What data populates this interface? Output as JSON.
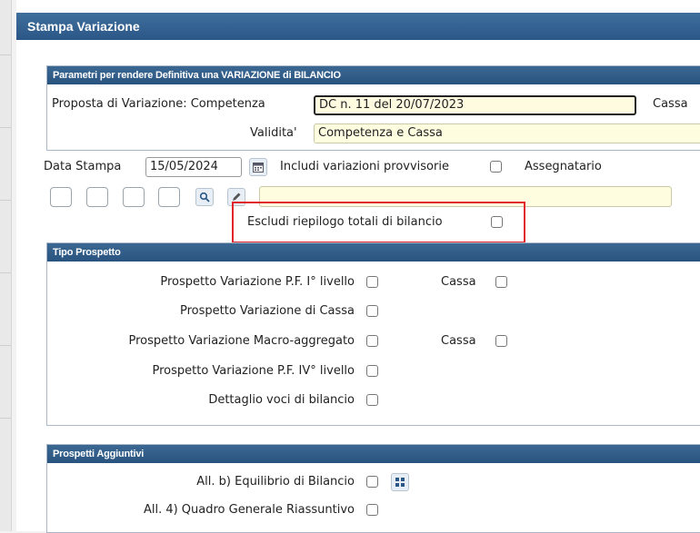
{
  "window": {
    "title": "Stampa Variazione"
  },
  "parametri": {
    "header": "Parametri per rendere Definitiva una VARIAZIONE di BILANCIO",
    "proposta_label": "Proposta di Variazione: Competenza",
    "proposta_value": "DC n. 11 del 20/07/2023",
    "cassa_label": "Cassa",
    "validita_label": "Validita'",
    "validita_value": "Competenza e Cassa"
  },
  "stampa": {
    "data_label": "Data Stampa",
    "data_value": "15/05/2024",
    "includi_label": "Includi variazioni provvisorie",
    "assegnatario_label": "Assegnatario",
    "escludi_label": "Escludi riepilogo totali di bilancio"
  },
  "tipo_prospetto": {
    "header": "Tipo Prospetto",
    "items": [
      {
        "label": "Prospetto Variazione P.F. I° livello",
        "cassa": "Cassa"
      },
      {
        "label": "Prospetto Variazione di Cassa"
      },
      {
        "label": "Prospetto Variazione Macro-aggregato",
        "cassa": "Cassa"
      },
      {
        "label": "Prospetto Variazione P.F. IV° livello"
      },
      {
        "label": "Dettaglio voci di bilancio"
      }
    ]
  },
  "prospetti_aggiuntivi": {
    "header": "Prospetti Aggiuntivi",
    "items": [
      {
        "label": "All. b) Equilibrio di Bilancio"
      },
      {
        "label": "All. 4) Quadro Generale Riassuntivo"
      }
    ]
  },
  "icons": {
    "calendar": "calendar-icon",
    "search": "search-icon",
    "edit": "pencil-icon",
    "grid": "grid-icon"
  },
  "colors": {
    "header_blue": "#2b5787",
    "highlight_red": "#e0262b",
    "input_yellow": "#fffde0"
  }
}
